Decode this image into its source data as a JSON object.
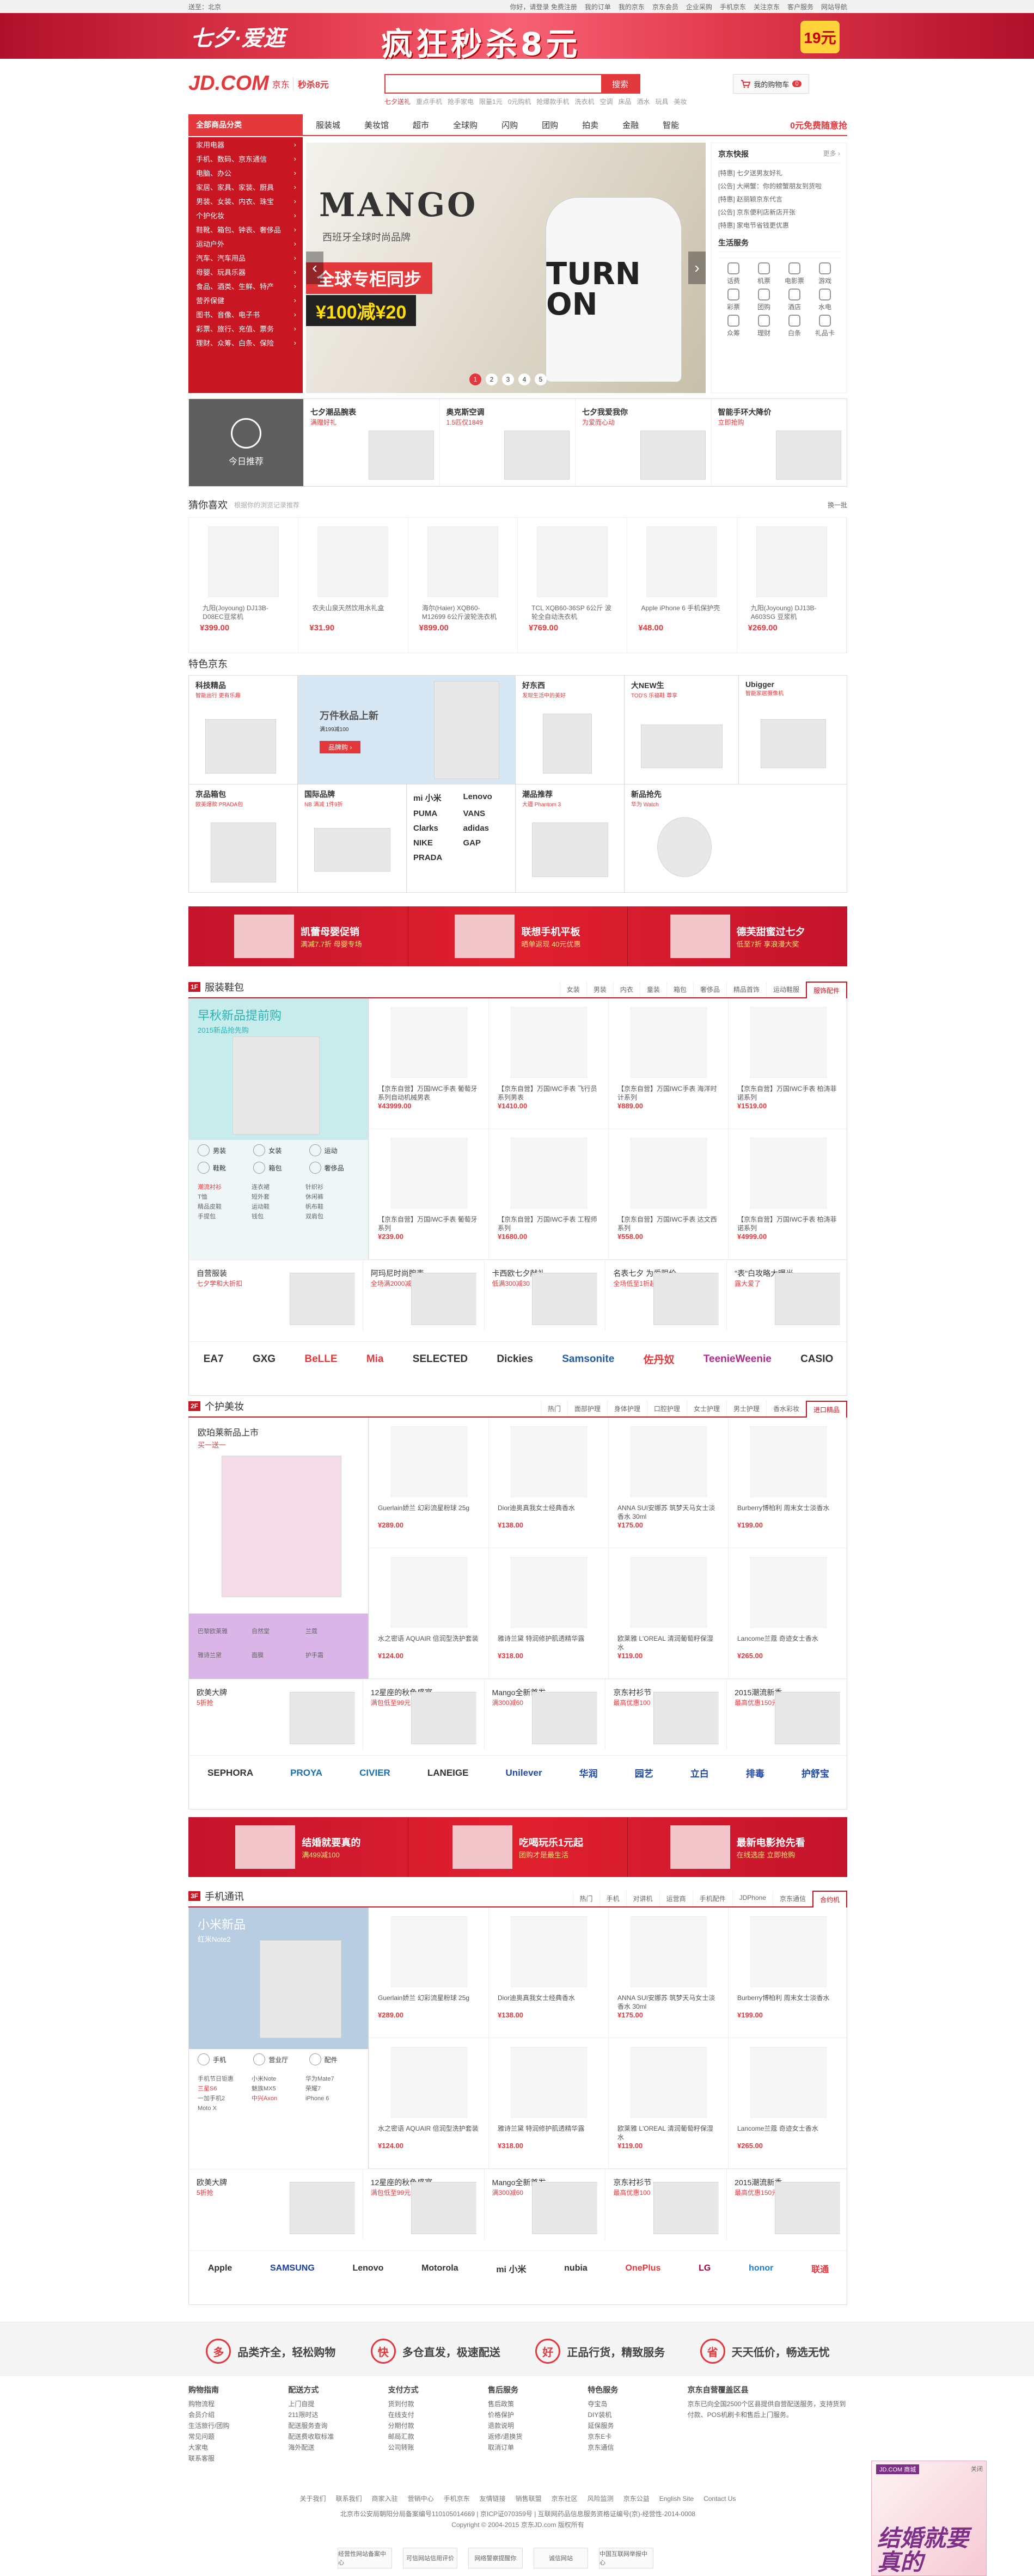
{
  "topbar": {
    "left": "送至：北京",
    "links": [
      "你好，请登录 免费注册",
      "我的订单",
      "我的京东",
      "京东会员",
      "企业采购",
      "手机京东",
      "关注京东",
      "客户服务",
      "网站导航"
    ]
  },
  "banner": {
    "logo": "七夕·爱逛",
    "title": "疯狂秒杀8元",
    "badge": "19元"
  },
  "header": {
    "logo": "JD.COM",
    "logo_cn": "京东",
    "logo_sub": "秒杀8元",
    "search_placeholder": "",
    "search_button": "搜索",
    "hot": [
      "七夕送礼",
      "重点手机",
      "抢手家电",
      "限量1元",
      "0元购机",
      "抢爆款手机",
      "洗衣机",
      "空调",
      "床品",
      "酒水",
      "玩具",
      "美妆"
    ],
    "cart": "我的购物车",
    "cart_count": "0"
  },
  "nav": {
    "all": "全部商品分类",
    "items": [
      "服装城",
      "美妆馆",
      "超市",
      "全球购",
      "闪购",
      "团购",
      "拍卖",
      "金融",
      "智能"
    ],
    "free": "0元免费随意抢"
  },
  "categories": [
    "家用电器",
    "手机、数码、京东通信",
    "电脑、办公",
    "家居、家具、家装、厨具",
    "男装、女装、内衣、珠宝",
    "个护化妆",
    "鞋靴、箱包、钟表、奢侈品",
    "运动户外",
    "汽车、汽车用品",
    "母婴、玩具乐器",
    "食品、酒类、生鲜、特产",
    "营养保健",
    "图书、音像、电子书",
    "彩票、旅行、充值、票务",
    "理财、众筹、白条、保险"
  ],
  "slider": {
    "brand": "MANGO",
    "headline": "全球专柜同步",
    "slogan": "西班牙全球时尚品牌",
    "coupon": "¥100减¥20",
    "shirt": "TURN ON",
    "pages": [
      "1",
      "2",
      "3",
      "4",
      "5"
    ]
  },
  "news": {
    "title": "京东快报",
    "more": "更多 ›",
    "items": [
      "[特惠] 七夕送男友好礼",
      "[公告] 大闸蟹：你的螃蟹朋友到货啦",
      "[特惠] 赵丽颖京东代言",
      "[公告] 京东便利店新店开张",
      "[特惠] 家电节省钱更优惠"
    ],
    "svc_title": "生活服务",
    "services": [
      "话费",
      "机票",
      "电影票",
      "游戏",
      "彩票",
      "团购",
      "酒店",
      "水电",
      "众筹",
      "理财",
      "白条",
      "礼品卡"
    ]
  },
  "today": {
    "label": "今日推荐",
    "items": [
      {
        "title": "七夕潮品腕表",
        "sub": "满赠好礼"
      },
      {
        "title": "奥克斯空调",
        "sub": "1.5匹仅1849"
      },
      {
        "title": "七夕我爱我你",
        "sub": "为爱而心动"
      },
      {
        "title": "智能手环大降价",
        "sub": "立即抢购"
      }
    ]
  },
  "guess": {
    "title": "猜你喜欢",
    "hint": "根据你的浏览记录推荐",
    "more": "换一批",
    "items": [
      {
        "name": "九阳(Joyoung) DJ13B-D08EC豆浆机",
        "price": "¥399.00"
      },
      {
        "name": "农夫山泉天然饮用水礼盒",
        "price": "¥31.90"
      },
      {
        "name": "海尔(Haier) XQB60-M12699 6公斤波轮洗衣机",
        "price": "¥899.00"
      },
      {
        "name": "TCL XQB60-36SP 6公斤 波轮全自动洗衣机",
        "price": "¥769.00"
      },
      {
        "name": "Apple iPhone 6 手机保护壳",
        "price": "¥48.00"
      },
      {
        "name": "九阳(Joyoung) DJ13B-A603SG 豆浆机",
        "price": "¥269.00"
      }
    ]
  },
  "special": {
    "title": "特色京东",
    "cells": [
      {
        "title": "科技精品",
        "sub": "智能出行 更有乐趣"
      },
      {
        "title": "万件秋品上新",
        "sub": "满199减100",
        "btn": "品牌购 ›"
      },
      {
        "title": "好东西",
        "sub": "发现生活中的美好"
      },
      {
        "title": "大NEW生",
        "sub": "TOD'S 乐福鞋 尊享"
      },
      {
        "title": "Ubigger",
        "sub": "智能家居摄像机"
      },
      {
        "title": "京品箱包",
        "sub": "欧美爆款 PRADA包"
      },
      {
        "title": "国际品牌",
        "sub": "NB 满减 1件9折"
      },
      {
        "title": "潮品推荐",
        "sub": "大疆 Phantom 3"
      },
      {
        "title": "新品抢先",
        "sub": "华为 Watch"
      }
    ],
    "brands": [
      "mi 小米",
      "Lenovo",
      "PUMA",
      "VANS",
      "Clarks",
      "adidas",
      "NIKE",
      "GAP",
      "PRADA"
    ]
  },
  "adbar": [
    {
      "t": "凯蕾母婴促销",
      "s": "满减7.7折 母婴专场"
    },
    {
      "t": "联想手机平板",
      "s": "晒单返现 40元优惠"
    },
    {
      "t": "德芙甜蜜过七夕",
      "s": "低至7折 享浪漫大奖"
    }
  ],
  "floor1": {
    "num": "1F",
    "title": "服装鞋包",
    "tabs": [
      "女装",
      "男装",
      "内衣",
      "童装",
      "箱包",
      "奢侈品",
      "精品首饰",
      "运动鞋服",
      "服饰配件"
    ],
    "hero": "早秋新品提前购",
    "hero_sub": "2015新品抢先购",
    "icons": [
      "男装",
      "女装",
      "运动",
      "鞋靴",
      "箱包",
      "奢侈品"
    ],
    "words": [
      "潮流衬衫",
      "连衣裙",
      "针织衫",
      "T恤",
      "短外套",
      "休闲裤",
      "精品皮鞋",
      "运动鞋",
      "帆布鞋",
      "手提包",
      "钱包",
      "双肩包"
    ],
    "items": [
      {
        "n": "【京东自营】万国IWC手表 葡萄牙系列自动机械男表",
        "p": "¥43999.00"
      },
      {
        "n": "【京东自营】万国IWC手表 飞行员系列男表",
        "p": "¥1410.00"
      },
      {
        "n": "【京东自营】万国IWC手表 海洋时计系列",
        "p": "¥889.00"
      },
      {
        "n": "【京东自营】万国IWC手表 柏涛菲诺系列",
        "p": "¥1519.00"
      },
      {
        "n": "【京东自营】万国IWC手表 葡萄牙系列",
        "p": "¥239.00"
      },
      {
        "n": "【京东自营】万国IWC手表 工程师系列",
        "p": "¥1680.00"
      },
      {
        "n": "【京东自营】万国IWC手表 达文西系列",
        "p": "¥558.00"
      },
      {
        "n": "【京东自营】万国IWC手表 柏涛菲诺系列",
        "p": "¥4999.00"
      }
    ],
    "promos": [
      {
        "t": "自营服装",
        "s": "七夕学和大折扣"
      },
      {
        "t": "阿玛尼时尚腕表",
        "s": "全场满2000减200"
      },
      {
        "t": "卡西欧七夕献礼",
        "s": "低满300减30"
      },
      {
        "t": "名表七夕 为爱限价",
        "s": "全场低至1折起"
      },
      {
        "t": "\"表\"白攻略大曝光",
        "s": "露大爱了"
      }
    ],
    "brands": [
      "EA7",
      "GXG",
      "BeLLE",
      "Mia",
      "SELECTED",
      "Dickies",
      "Samsonite",
      "佐丹奴",
      "TeenieWeenie",
      "CASIO"
    ]
  },
  "floor2": {
    "num": "2F",
    "title": "个护美妆",
    "tabs": [
      "热门",
      "面部护理",
      "身体护理",
      "口腔护理",
      "女士护理",
      "男士护理",
      "香水彩妆",
      "进口精品"
    ],
    "hero": "欧珀莱新品上市",
    "hero_sub": "买一送一",
    "words": [
      "巴黎欧莱雅",
      "自然堂",
      "兰蔻",
      "雅诗兰黛",
      "面膜",
      "护手霜"
    ],
    "items": [
      {
        "n": "Guerlain娇兰 幻彩流星粉球 25g",
        "p": "¥289.00"
      },
      {
        "n": "Dior迪奥真我女士经典香水",
        "p": "¥138.00"
      },
      {
        "n": "ANNA SUI安娜苏 筑梦天马女士淡香水 30ml",
        "p": "¥175.00"
      },
      {
        "n": "Burberry博柏利 周末女士淡香水",
        "p": "¥199.00"
      },
      {
        "n": "水之密语 AQUAIR 倍润型洗护套装",
        "p": "¥124.00"
      },
      {
        "n": "雅诗兰黛 特润修护肌透精华露",
        "p": "¥318.00"
      },
      {
        "n": "欧莱雅 L'OREAL 清润葡萄籽保湿水",
        "p": "¥119.00"
      },
      {
        "n": "Lancome兰蔻 奇迹女士香水",
        "p": "¥265.00"
      }
    ],
    "promos": [
      {
        "t": "欧美大牌",
        "s": "5折抢"
      },
      {
        "t": "12星座的秋色盛宴",
        "s": "满包低至99元"
      },
      {
        "t": "Mango全新首发",
        "s": "满300减60"
      },
      {
        "t": "京东衬衫节",
        "s": "最高优惠100"
      },
      {
        "t": "2015潮流新季",
        "s": "最高优惠150元券"
      }
    ],
    "brands": [
      "SEPHORA",
      "PROYA",
      "CIVIER",
      "LANEIGE",
      "Unilever",
      "华润",
      "园艺",
      "立白",
      "排毒",
      "护舒宝"
    ]
  },
  "adbar2": [
    {
      "t": "结婚就要真的",
      "s": "满499减100"
    },
    {
      "t": "吃喝玩乐1元起",
      "s": "团购才是最生活"
    },
    {
      "t": "最新电影抢先看",
      "s": "在线选座 立即抢购"
    }
  ],
  "floor3": {
    "num": "3F",
    "title": "手机通讯",
    "tabs": [
      "热门",
      "手机",
      "对讲机",
      "运营商",
      "手机配件",
      "JDPhone",
      "京东通信",
      "合约机"
    ],
    "hero": "小米新品",
    "hero_sub": "红米Note2",
    "icons": [
      "手机",
      "营业厅",
      "配件"
    ],
    "words": [
      "手机节日钜惠",
      "小米Note",
      "华为Mate7",
      "三星S6",
      "魅族MX5",
      "荣耀7",
      "一加手机2",
      "中兴Axon",
      "iPhone 6",
      "Moto X"
    ],
    "items": [
      {
        "n": "Guerlain娇兰 幻彩流星粉球 25g",
        "p": "¥289.00"
      },
      {
        "n": "Dior迪奥真我女士经典香水",
        "p": "¥138.00"
      },
      {
        "n": "ANNA SUI安娜苏 筑梦天马女士淡香水 30ml",
        "p": "¥175.00"
      },
      {
        "n": "Burberry博柏利 周末女士淡香水",
        "p": "¥199.00"
      },
      {
        "n": "水之密语 AQUAIR 倍润型洗护套装",
        "p": "¥124.00"
      },
      {
        "n": "雅诗兰黛 特润修护肌透精华露",
        "p": "¥318.00"
      },
      {
        "n": "欧莱雅 L'OREAL 清润葡萄籽保湿水",
        "p": "¥119.00"
      },
      {
        "n": "Lancome兰蔻 奇迹女士香水",
        "p": "¥265.00"
      }
    ],
    "promos": [
      {
        "t": "欧美大牌",
        "s": "5折抢"
      },
      {
        "t": "12星座的秋色盛宴",
        "s": "满包低至99元"
      },
      {
        "t": "Mango全新首发",
        "s": "满300减60"
      },
      {
        "t": "京东衬衫节",
        "s": "最高优惠100"
      },
      {
        "t": "2015潮流新季",
        "s": "最高优惠150元券"
      }
    ],
    "brands": [
      "Apple",
      "SAMSUNG",
      "Lenovo",
      "Motorola",
      "mi 小米",
      "nubia",
      "OnePlus",
      "LG",
      "honor",
      "联通"
    ]
  },
  "services": [
    {
      "i": "多",
      "t": "品类齐全，轻松购物"
    },
    {
      "i": "快",
      "t": "多仓直发，极速配送"
    },
    {
      "i": "好",
      "t": "正品行货，精致服务"
    },
    {
      "i": "省",
      "t": "天天低价，畅选无忧"
    }
  ],
  "footer": {
    "cols": [
      {
        "h": "购物指南",
        "l": [
          "购物流程",
          "会员介绍",
          "生活旅行/团购",
          "常见问题",
          "大家电",
          "联系客服"
        ]
      },
      {
        "h": "配送方式",
        "l": [
          "上门自提",
          "211限时达",
          "配送服务查询",
          "配送费收取标准",
          "海外配送"
        ]
      },
      {
        "h": "支付方式",
        "l": [
          "货到付款",
          "在线支付",
          "分期付款",
          "邮局汇款",
          "公司转账"
        ]
      },
      {
        "h": "售后服务",
        "l": [
          "售后政策",
          "价格保护",
          "退款说明",
          "返修/退换货",
          "取消订单"
        ]
      },
      {
        "h": "特色服务",
        "l": [
          "夺宝岛",
          "DIY装机",
          "延保服务",
          "京东E卡",
          "京东通信"
        ]
      },
      {
        "h": "京东自营覆盖区县",
        "l": [
          "京东已向全国2500个区县提供自营配送服务，支持货到付款、POS机刷卡和售后上门服务。"
        ]
      }
    ],
    "links": [
      "关于我们",
      "联系我们",
      "商家入驻",
      "营销中心",
      "手机京东",
      "友情链接",
      "销售联盟",
      "京东社区",
      "风险监测",
      "京东公益",
      "English Site",
      "Contact Us"
    ],
    "copy": "北京市公安局朝阳分局备案编号110105014669  |  京ICP证070359号  |  互联网药品信息服务资格证编号(京)-经营性-2014-0008",
    "copy2": "Copyright © 2004-2015 京东JD.com 版权所有",
    "badges": [
      "经营性网站备案中心",
      "可信网站信用评价",
      "网络警察提醒你",
      "诚信网站",
      "中国互联网举报中心"
    ]
  },
  "flyad": {
    "label": "JD.COM 商城",
    "text": "结婚就要真的",
    "close": "关闭"
  }
}
